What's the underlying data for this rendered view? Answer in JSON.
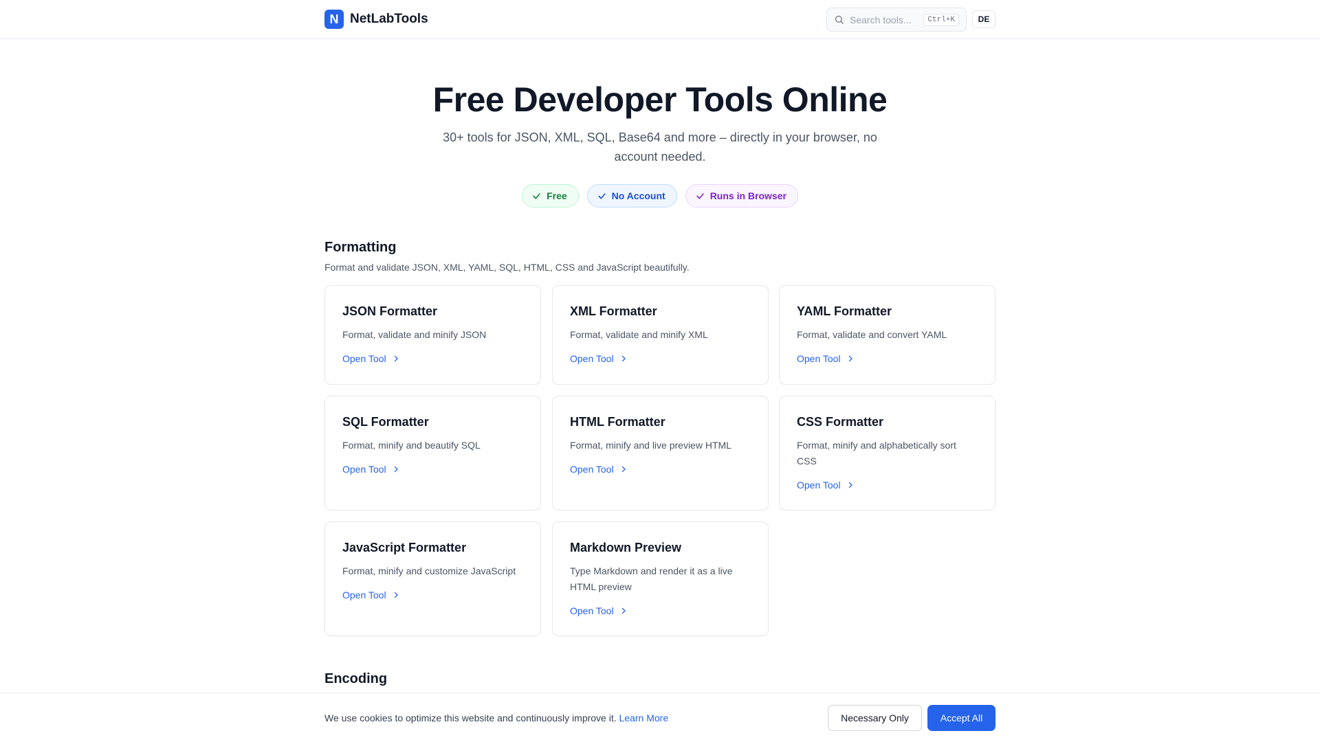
{
  "header": {
    "logo_letter": "N",
    "brand": "NetLabTools",
    "search_placeholder": "Search tools...",
    "search_shortcut": "Ctrl+K",
    "language": "DE"
  },
  "hero": {
    "title": "Free Developer Tools Online",
    "subtitle": "30+ tools for JSON, XML, SQL, Base64 and more – directly in your browser, no account needed.",
    "badges": [
      {
        "label": "Free",
        "color": "#15803d"
      },
      {
        "label": "No Account",
        "color": "#1d4ed8"
      },
      {
        "label": "Runs in Browser",
        "color": "#7e22ce"
      }
    ]
  },
  "sections": [
    {
      "title": "Formatting",
      "description": "Format and validate JSON, XML, YAML, SQL, HTML, CSS and JavaScript beautifully.",
      "tools": [
        {
          "name": "JSON Formatter",
          "description": "Format, validate and minify JSON",
          "link": "Open Tool"
        },
        {
          "name": "XML Formatter",
          "description": "Format, validate and minify XML",
          "link": "Open Tool"
        },
        {
          "name": "YAML Formatter",
          "description": "Format, validate and convert YAML",
          "link": "Open Tool"
        },
        {
          "name": "SQL Formatter",
          "description": "Format, minify and beautify SQL",
          "link": "Open Tool"
        },
        {
          "name": "HTML Formatter",
          "description": "Format, minify and live preview HTML",
          "link": "Open Tool"
        },
        {
          "name": "CSS Formatter",
          "description": "Format, minify and alphabetically sort CSS",
          "link": "Open Tool"
        },
        {
          "name": "JavaScript Formatter",
          "description": "Format, minify and customize JavaScript",
          "link": "Open Tool"
        },
        {
          "name": "Markdown Preview",
          "description": "Type Markdown and render it as a live HTML preview",
          "link": "Open Tool"
        }
      ]
    },
    {
      "title": "Encoding"
    }
  ],
  "cookie_banner": {
    "text": "We use cookies to optimize this website and continuously improve it.",
    "learn_more": "Learn More",
    "necessary_only": "Necessary Only",
    "accept_all": "Accept All"
  },
  "colors": {
    "accent": "#2563eb",
    "border": "#e5e7eb",
    "text": "#111827",
    "muted": "#4b5563"
  }
}
